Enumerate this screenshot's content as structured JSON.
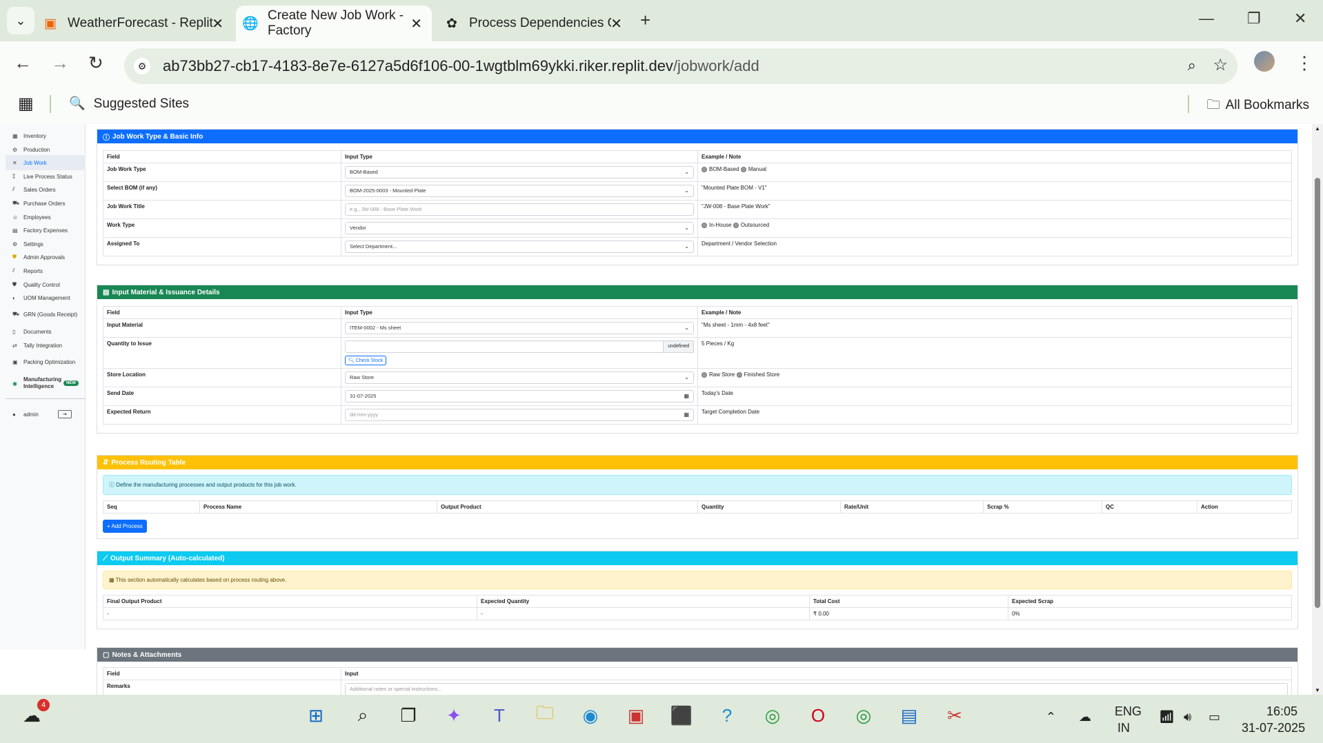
{
  "browser": {
    "tabs": [
      {
        "title": "WeatherForecast - Replit",
        "icon": "replit-icon"
      },
      {
        "title": "Create New Job Work - Factory",
        "icon": "globe-icon",
        "active": true
      },
      {
        "title": "Process Dependencies Overview",
        "icon": "openai-icon"
      }
    ],
    "url_host": "ab73bb27-cb17-4183-8e7e-6127a5d6f106-00-1wgtblm69ykki.riker.replit.dev",
    "url_path": "/jobwork/add",
    "bookmarks": {
      "suggested": "Suggested Sites",
      "all": "All Bookmarks"
    }
  },
  "sidebar": {
    "items": [
      {
        "label": "Inventory",
        "icon": "boxes-icon"
      },
      {
        "label": "Production",
        "icon": "gears-icon"
      },
      {
        "label": "Job Work",
        "icon": "tools-icon",
        "active": true
      },
      {
        "label": "Live Process Status",
        "icon": "broadcast-icon"
      },
      {
        "label": "Sales Orders",
        "icon": "chart-icon"
      },
      {
        "label": "Purchase Orders",
        "icon": "truck-icon"
      },
      {
        "label": "Employees",
        "icon": "users-icon"
      },
      {
        "label": "Factory Expenses",
        "icon": "receipt-icon"
      },
      {
        "label": "Settings",
        "icon": "gear-icon"
      },
      {
        "label": "Admin Approvals",
        "icon": "shield-icon"
      },
      {
        "label": "Reports",
        "icon": "report-icon"
      },
      {
        "label": "Quality Control",
        "icon": "check-shield-icon"
      },
      {
        "label": "UOM Management",
        "icon": "ruler-icon"
      },
      {
        "label": "GRN (Goods Receipt)",
        "icon": "truck-loading-icon"
      },
      {
        "label": "Documents",
        "icon": "file-icon"
      },
      {
        "label": "Tally Integration",
        "icon": "sync-icon"
      },
      {
        "label": "Packing Optimization",
        "icon": "box-icon"
      },
      {
        "label": "Manufacturing Intelligence",
        "icon": "brain-icon",
        "badge": "NEW"
      }
    ],
    "user": "admin"
  },
  "basic": {
    "title": "Job Work Type & Basic Info",
    "headers": [
      "Field",
      "Input Type",
      "Example / Note"
    ],
    "rows": [
      {
        "field": "Job Work Type",
        "value": "BOM-Based",
        "note_radios": [
          "BOM-Based",
          "Manual"
        ]
      },
      {
        "field": "Select BOM (if any)",
        "value": "BOM-2025-0003 - Mounted Plate",
        "note": "\"Mounted Plate BOM - V1\""
      },
      {
        "field": "Job Work Title",
        "placeholder": "e.g., JW-008 - Base Plate Work",
        "note": "\"JW-008 - Base Plate Work\""
      },
      {
        "field": "Work Type",
        "value": "Vendor",
        "note_radios": [
          "In-House",
          "Outsourced"
        ]
      },
      {
        "field": "Assigned To",
        "value": "Select Department...",
        "note": "Department / Vendor Selection"
      }
    ]
  },
  "material": {
    "title": "Input Material & Issuance Details",
    "headers": [
      "Field",
      "Input Type",
      "Example / Note"
    ],
    "input_material": {
      "field": "Input Material",
      "value": "ITEM-0002 - Ms sheet",
      "note": "\"Ms sheet - 1mm - 4x8 feet\""
    },
    "quantity": {
      "field": "Quantity to Issue",
      "unit": "undefined",
      "check": "Check Stock",
      "note": "5 Pieces / Kg"
    },
    "store": {
      "field": "Store Location",
      "value": "Raw Store",
      "note_radios": [
        "Raw Store",
        "Finished Store"
      ]
    },
    "send_date": {
      "field": "Send Date",
      "value": "31-07-2025",
      "note": "Today's Date"
    },
    "return_date": {
      "field": "Expected Return",
      "value": "dd-mm-yyyy",
      "note": "Target Completion Date"
    }
  },
  "routing": {
    "title": "Process Routing Table",
    "info": "Define the manufacturing processes and output products for this job work.",
    "headers": [
      "Seq",
      "Process Name",
      "Output Product",
      "Quantity",
      "Rate/Unit",
      "Scrap %",
      "QC",
      "Action"
    ],
    "add_button": "Add Process"
  },
  "summary": {
    "title": "Output Summary (Auto-calculated)",
    "info": "This section automatically calculates based on process routing above.",
    "headers": [
      "Final Output Product",
      "Expected Quantity",
      "Total Cost",
      "Expected Scrap"
    ],
    "values": [
      "-",
      "-",
      "₹ 0.00",
      "0%"
    ]
  },
  "notes": {
    "title": "Notes & Attachments",
    "headers": [
      "Field",
      "Input"
    ],
    "remarks_label": "Remarks",
    "remarks_placeholder": "Additional notes or special instructions..."
  },
  "taskbar": {
    "weather_badge": "4",
    "lang": "ENG",
    "region": "IN",
    "time": "16:05",
    "date": "31-07-2025"
  },
  "colors": {
    "primary": "#0d6efd",
    "success": "#198754",
    "warning": "#ffc107",
    "info": "#0dcaf0",
    "secondary": "#6c757d"
  }
}
